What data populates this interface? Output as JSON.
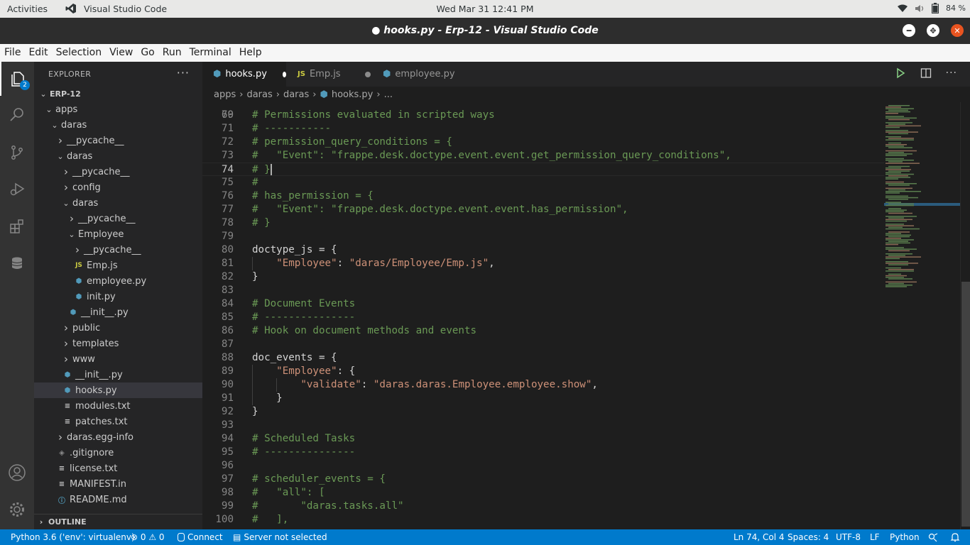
{
  "topbar": {
    "activities": "Activities",
    "app_name": "Visual Studio Code",
    "clock": "Wed Mar 31  12:41 PM",
    "battery": "84 %"
  },
  "window": {
    "title": "● hooks.py - Erp-12 - Visual Studio Code"
  },
  "menu": [
    "File",
    "Edit",
    "Selection",
    "View",
    "Go",
    "Run",
    "Terminal",
    "Help"
  ],
  "activity_bar": {
    "explorer_badge": "2"
  },
  "explorer": {
    "title": "EXPLORER",
    "more": "···",
    "tree": [
      {
        "label": "ERP-12",
        "depth": 0,
        "chev": "open",
        "icon": ""
      },
      {
        "label": "apps",
        "depth": 1,
        "chev": "open",
        "icon": ""
      },
      {
        "label": "daras",
        "depth": 2,
        "chev": "open",
        "icon": ""
      },
      {
        "label": "__pycache__",
        "depth": 3,
        "chev": "closed",
        "icon": ""
      },
      {
        "label": "daras",
        "depth": 3,
        "chev": "open",
        "icon": ""
      },
      {
        "label": "__pycache__",
        "depth": 4,
        "chev": "closed",
        "icon": ""
      },
      {
        "label": "config",
        "depth": 4,
        "chev": "closed",
        "icon": ""
      },
      {
        "label": "daras",
        "depth": 4,
        "chev": "open",
        "icon": ""
      },
      {
        "label": "__pycache__",
        "depth": 5,
        "chev": "closed",
        "icon": ""
      },
      {
        "label": "Employee",
        "depth": 5,
        "chev": "open",
        "icon": ""
      },
      {
        "label": "__pycache__",
        "depth": 6,
        "chev": "closed",
        "icon": ""
      },
      {
        "label": "Emp.js",
        "depth": 6,
        "chev": "none",
        "icon": "js"
      },
      {
        "label": "employee.py",
        "depth": 6,
        "chev": "none",
        "icon": "py"
      },
      {
        "label": "init.py",
        "depth": 6,
        "chev": "none",
        "icon": "py"
      },
      {
        "label": "__init__.py",
        "depth": 5,
        "chev": "none",
        "icon": "py"
      },
      {
        "label": "public",
        "depth": 4,
        "chev": "closed",
        "icon": ""
      },
      {
        "label": "templates",
        "depth": 4,
        "chev": "closed",
        "icon": ""
      },
      {
        "label": "www",
        "depth": 4,
        "chev": "closed",
        "icon": ""
      },
      {
        "label": "__init__.py",
        "depth": 4,
        "chev": "none",
        "icon": "py"
      },
      {
        "label": "hooks.py",
        "depth": 4,
        "chev": "none",
        "icon": "py",
        "selected": true
      },
      {
        "label": "modules.txt",
        "depth": 4,
        "chev": "none",
        "icon": "txt"
      },
      {
        "label": "patches.txt",
        "depth": 4,
        "chev": "none",
        "icon": "txt"
      },
      {
        "label": "daras.egg-info",
        "depth": 3,
        "chev": "closed",
        "icon": ""
      },
      {
        "label": ".gitignore",
        "depth": 3,
        "chev": "none",
        "icon": "git"
      },
      {
        "label": "license.txt",
        "depth": 3,
        "chev": "none",
        "icon": "txt"
      },
      {
        "label": "MANIFEST.in",
        "depth": 3,
        "chev": "none",
        "icon": "txt"
      },
      {
        "label": "README.md",
        "depth": 3,
        "chev": "none",
        "icon": "info"
      }
    ],
    "outline": "OUTLINE"
  },
  "tabs": [
    {
      "label": "hooks.py",
      "icon": "py",
      "active": true,
      "dirty": true
    },
    {
      "label": "Emp.js",
      "icon": "js",
      "active": false,
      "dirty": true
    },
    {
      "label": "employee.py",
      "icon": "py",
      "active": false,
      "dirty": false
    }
  ],
  "breadcrumb": [
    "apps",
    "daras",
    "daras",
    "hooks.py",
    "..."
  ],
  "editor": {
    "current_line": 74,
    "cursor_position": "Ln 74, Col 4",
    "lines": [
      {
        "n": "70",
        "t": "# Permissions evaluated in scripted ways",
        "k": "comment"
      },
      {
        "n": "71",
        "t": "",
        "k": "plain"
      },
      {
        "n": "72",
        "t": "# permission_query_conditions = {",
        "k": "comment"
      },
      {
        "n": "73",
        "t": "#   \"Event\": \"frappe.desk.doctype.event.event.get_permission_query_conditions\",",
        "k": "comment"
      },
      {
        "n": "74",
        "t": "# }",
        "k": "comment"
      },
      {
        "n": "75",
        "t": "#",
        "k": "comment"
      },
      {
        "n": "76",
        "t": "# has_permission = {",
        "k": "comment"
      },
      {
        "n": "77",
        "t": "#   \"Event\": \"frappe.desk.doctype.event.event.has_permission\",",
        "k": "comment"
      },
      {
        "n": "78",
        "t": "# }",
        "k": "comment"
      },
      {
        "n": "79",
        "t": "",
        "k": "plain"
      },
      {
        "n": "80",
        "t": "doctype_js = {",
        "k": "plain"
      },
      {
        "n": "81",
        "t": "    \"Employee\": \"daras/Employee/Emp.js\",",
        "k": "mixed1"
      },
      {
        "n": "82",
        "t": "}",
        "k": "plain"
      },
      {
        "n": "83",
        "t": "",
        "k": "plain"
      },
      {
        "n": "84",
        "t": "# Document Events",
        "k": "comment"
      },
      {
        "n": "85",
        "t": "# ---------------",
        "k": "comment"
      },
      {
        "n": "86",
        "t": "# Hook on document methods and events",
        "k": "comment"
      },
      {
        "n": "87",
        "t": "",
        "k": "plain"
      },
      {
        "n": "88",
        "t": "doc_events = {",
        "k": "plain"
      },
      {
        "n": "89",
        "t": "    \"Employee\": {",
        "k": "mixed2"
      },
      {
        "n": "90",
        "t": "        \"validate\": \"daras.daras.Employee.employee.show\",",
        "k": "mixed3"
      },
      {
        "n": "91",
        "t": "    }",
        "k": "plain"
      },
      {
        "n": "92",
        "t": "}",
        "k": "plain"
      },
      {
        "n": "93",
        "t": "",
        "k": "plain"
      },
      {
        "n": "94",
        "t": "# Scheduled Tasks",
        "k": "comment"
      },
      {
        "n": "95",
        "t": "# ---------------",
        "k": "comment"
      },
      {
        "n": "96",
        "t": "",
        "k": "plain"
      },
      {
        "n": "97",
        "t": "# scheduler_events = {",
        "k": "comment"
      },
      {
        "n": "98",
        "t": "#   \"all\": [",
        "k": "comment"
      },
      {
        "n": "99",
        "t": "#       \"daras.tasks.all\"",
        "k": "comment"
      },
      {
        "n": "100",
        "t": "#   ],",
        "k": "comment"
      }
    ]
  },
  "statusbar": {
    "python": "Python 3.6 ('env': virtualenv)",
    "problems": "⊗ 0 ⚠ 0",
    "connect": "Connect",
    "server": "Server not selected",
    "position": "Ln 74, Col 4",
    "spaces": "Spaces: 4",
    "encoding": "UTF-8",
    "eol": "LF",
    "language": "Python"
  },
  "colors": {
    "statusbar": "#007acc",
    "comment": "#6a9955",
    "string": "#ce9178",
    "close_button": "#e95420"
  }
}
